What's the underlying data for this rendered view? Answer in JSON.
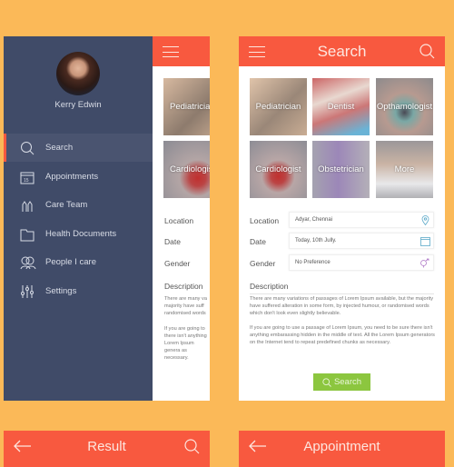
{
  "colors": {
    "background": "#fbb958",
    "header": "#f8593f",
    "drawer": "#404b68",
    "button": "#8cc63f"
  },
  "drawer": {
    "user_name": "Kerry Edwin",
    "items": [
      {
        "label": "Search",
        "icon": "search-icon",
        "active": true
      },
      {
        "label": "Appointments",
        "icon": "calendar-icon"
      },
      {
        "label": "Care Team",
        "icon": "care-team-icon"
      },
      {
        "label": "Health Documents",
        "icon": "folder-icon"
      },
      {
        "label": "People I care",
        "icon": "people-icon"
      },
      {
        "label": "Settings",
        "icon": "sliders-icon"
      }
    ]
  },
  "left_screen": {
    "tiles": [
      "Pediatricia",
      "Cardiologis"
    ],
    "labels": [
      "Location",
      "Date",
      "Gender",
      "Description"
    ],
    "desc1": "There are many va majority have suff randomised words",
    "desc2": "If you are going to there isn't anything Lorem Ipsum genera as necessary."
  },
  "search": {
    "title": "Search",
    "tiles": [
      "Pediatrician",
      "Dentist",
      "Opthamologist",
      "Cardiologist",
      "Obstetrician",
      "More"
    ],
    "location_label": "Location",
    "location_value": "Adyar, Chennai",
    "date_label": "Date",
    "date_value": "Today, 10th Jully.",
    "gender_label": "Gender",
    "gender_value": "No Preference",
    "description_label": "Description",
    "description_p1": "There are many variations of passages of Lorem Ipsum available, but the majority have suffered alteration in some form, by injected humour, or randomised words which don't look even slightly believable.",
    "description_p2": "If you are going to use a passage of Lorem Ipsum, you need to be sure there isn't anything embarassing hidden in the middle of text. All the Lorem Ipsum generators on the Internet tend to repeat predefined chunks as necessary.",
    "button": "Search"
  },
  "result": {
    "title": "Result"
  },
  "appointment": {
    "title": "Appointment"
  }
}
